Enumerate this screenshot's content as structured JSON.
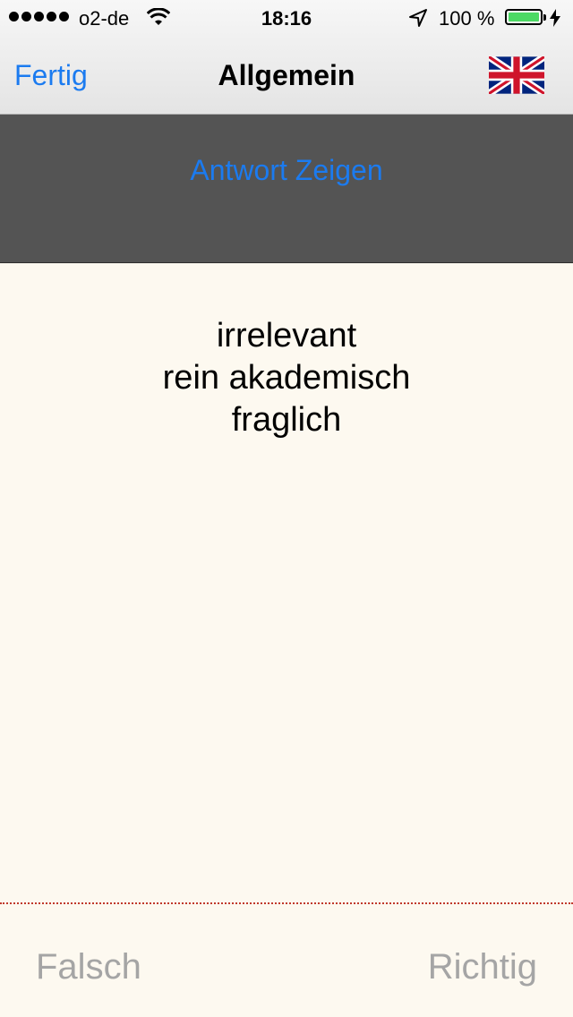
{
  "status_bar": {
    "carrier": "o2-de",
    "signal_icon": "signal-dots-icon",
    "wifi_icon": "wifi-icon",
    "time": "18:16",
    "location_icon": "location-arrow-icon",
    "battery_percent": "100 %",
    "battery_icon": "battery-icon",
    "battery_level": 1.0,
    "charging_icon": "charging-bolt-icon"
  },
  "nav": {
    "done_label": "Fertig",
    "title": "Allgemein",
    "language_icon": "uk-flag-icon"
  },
  "reveal": {
    "label": "Antwort Zeigen"
  },
  "card": {
    "lines": [
      "irrelevant",
      "rein akademisch",
      "fraglich"
    ]
  },
  "answers": {
    "wrong_label": "Falsch",
    "right_label": "Richtig"
  },
  "colors": {
    "accent": "#1b7bf0",
    "band": "#545454",
    "card_bg": "#fdf9f0",
    "answer_text": "#a5a5a5",
    "divider": "#c0392b",
    "battery_fill": "#4cd964"
  }
}
